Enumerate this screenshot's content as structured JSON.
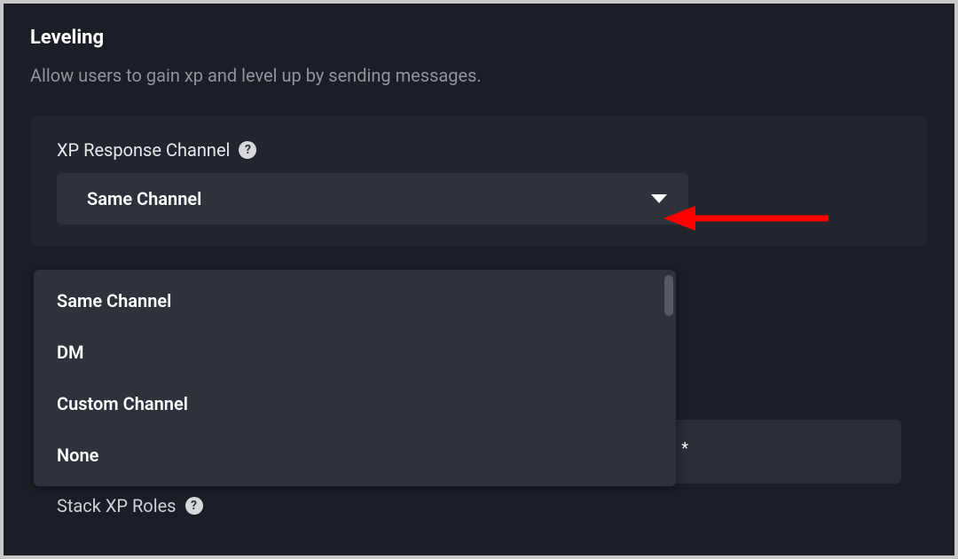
{
  "section": {
    "title": "Leveling",
    "description": "Allow users to gain xp and level up by sending messages."
  },
  "xp_response": {
    "label": "XP Response Channel",
    "selected": "Same Channel",
    "options": [
      "Same Channel",
      "DM",
      "Custom Channel",
      "None"
    ]
  },
  "hidden_input_star": "*",
  "stack_roles": {
    "label": "Stack XP Roles"
  },
  "help_glyph": "?"
}
